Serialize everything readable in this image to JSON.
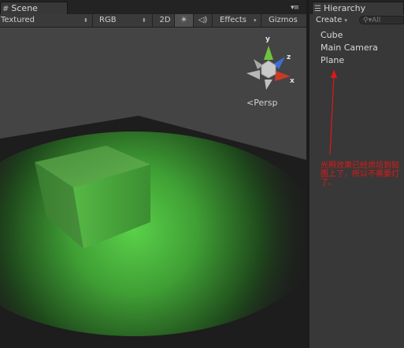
{
  "scene": {
    "tab_label": "Scene",
    "toolbar": {
      "shading_mode": "Textured",
      "render_mode": "RGB",
      "mode_2d": "2D",
      "effects": "Effects",
      "gizmos": "Gizmos"
    },
    "persp_label": "Persp",
    "gizmo_axes": {
      "y": "y",
      "z": "z",
      "x": "x"
    },
    "colors": {
      "cube": "#3c9d33",
      "glow": "#5ad04a",
      "floor": "#1e1e1e"
    }
  },
  "hierarchy": {
    "tab_label": "Hierarchy",
    "create_label": "Create",
    "search_placeholder": "All",
    "items": [
      "Cube",
      "Main Camera",
      "Plane"
    ]
  },
  "annotation": {
    "text": "光照效果已经烘培到贴图上了，所以不需要灯了。",
    "color": "#e01818"
  }
}
